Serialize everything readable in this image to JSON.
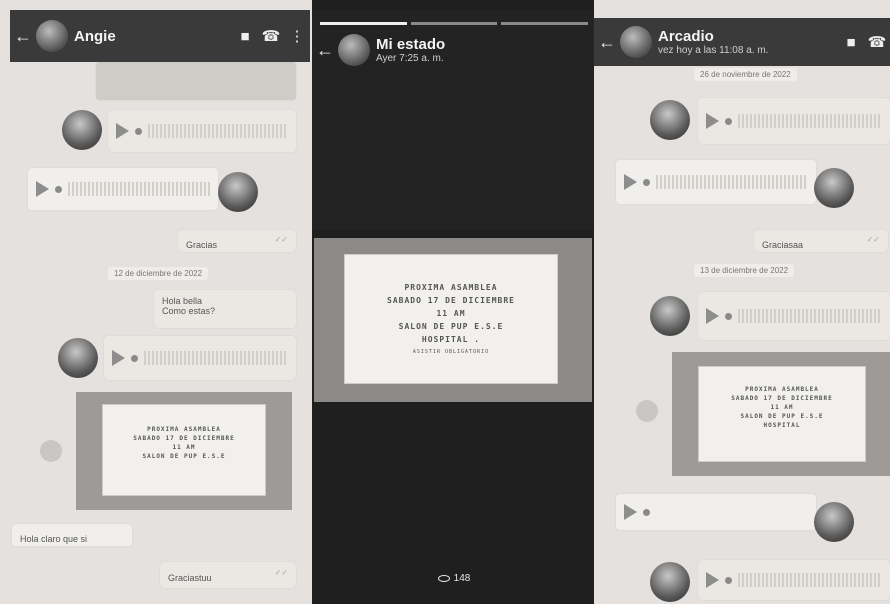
{
  "left_chat": {
    "contact_name": "Angie",
    "messages": {
      "thanks_out": "Gracias",
      "date_divider": "12 de diciembre de 2022",
      "hello_out_line1": "Hola bella",
      "hello_out_line2": "Como estas?",
      "reply_in": "Hola claro que si",
      "thanks_out_2": "Graciastuu"
    },
    "icons": [
      "back-arrow-icon",
      "video-call-icon",
      "phone-icon",
      "more-icon"
    ]
  },
  "status_view": {
    "title": "Mi estado",
    "subtitle": "Ayer 7:25 a. m.",
    "flyer": {
      "line1": "PROXIMA ASAMBLEA",
      "line2": "SABADO 17 DE DICIEMBRE",
      "line3": "11 AM",
      "line4": "SALON DE PUP E.S.E",
      "line5": "HOSPITAL .",
      "footer": "ASISTIR OBLIGATORIO"
    },
    "views_count": "148"
  },
  "right_chat": {
    "contact_name": "Arcadio",
    "last_seen": "vez hoy a las 11:08 a. m.",
    "date_divider_1": "26 de noviembre de 2022",
    "thanks_out": "Graciasaa",
    "date_divider_2": "13 de diciembre de 2022",
    "flyer": {
      "line1": "PROXIMA ASAMBLEA",
      "line2": "SABADO 17 DE DICIEMBRE",
      "line3": "11 AM",
      "line4": "SALON DE PUP E.S.E",
      "line5": "HOSPITAL"
    }
  },
  "colors": {
    "header": "#3a3a3a",
    "chat_bg": "#e4e1de",
    "status_bg": "#1f1f1f"
  }
}
